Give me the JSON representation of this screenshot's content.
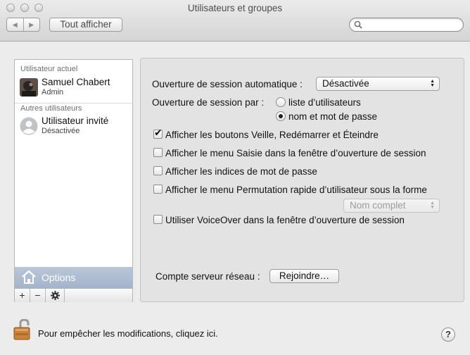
{
  "window": {
    "title": "Utilisateurs et groupes"
  },
  "toolbar": {
    "back_icon": "back-arrow-icon",
    "forward_icon": "forward-arrow-icon",
    "show_all_label": "Tout afficher",
    "search_placeholder": "",
    "search_value": ""
  },
  "sidebar": {
    "current_user_heading": "Utilisateur actuel",
    "current_user": {
      "name": "Samuel Chabert",
      "role": "Admin"
    },
    "other_users_heading": "Autres utilisateurs",
    "other_users": [
      {
        "name": "Utilisateur invité",
        "status": "Désactivée"
      }
    ],
    "options_label": "Options",
    "add_label": "+",
    "remove_label": "−",
    "gear_icon": "gear-icon"
  },
  "options": {
    "auto_login_label": "Ouverture de session automatique :",
    "auto_login_value": "Désactivée",
    "login_by_label": "Ouverture de session par :",
    "login_by_options": [
      {
        "label": "liste d’utilisateurs",
        "selected": false
      },
      {
        "label": "nom et mot de passe",
        "selected": true
      }
    ],
    "checkboxes": [
      {
        "label": "Afficher les boutons Veille, Redémarrer et Éteindre",
        "checked": true
      },
      {
        "label": "Afficher le menu Saisie dans la fenêtre d’ouverture de session",
        "checked": false
      },
      {
        "label": "Afficher les indices de mot de passe",
        "checked": false
      },
      {
        "label": "Afficher le menu Permutation rapide d’utilisateur sous la forme",
        "checked": false
      },
      {
        "label": "Utiliser VoiceOver dans la fenêtre d’ouverture de session",
        "checked": false
      }
    ],
    "fast_switch_format": "Nom complet",
    "network_account_label": "Compte serveur réseau :",
    "join_button_label": "Rejoindre…"
  },
  "footer": {
    "lock_text": "Pour empêcher les modifications, cliquez ici.",
    "help_label": "?"
  }
}
